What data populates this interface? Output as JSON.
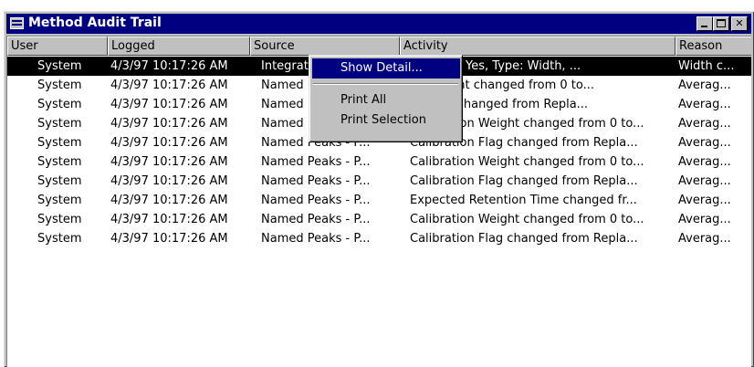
{
  "window": {
    "title": "Method Audit Trail",
    "min_glyph": "",
    "max_glyph": "",
    "close_glyph": "✕"
  },
  "columns": [
    "User",
    "Logged",
    "Source",
    "Activity",
    "Reason"
  ],
  "rows": [
    {
      "user": "System",
      "logged": "4/3/97 10:17:26 AM",
      "source": "Integrat",
      "activity": "Enabled: Yes, Type: Width, ...",
      "reason": "Width c...",
      "selected": true
    },
    {
      "user": "System",
      "logged": "4/3/97 10:17:26 AM",
      "source": "Named",
      "activity": "on Weight changed from 0 to...",
      "reason": "Averag..."
    },
    {
      "user": "System",
      "logged": "4/3/97 10:17:26 AM",
      "source": "Named",
      "activity": "on Flag changed from Repla...",
      "reason": "Averag..."
    },
    {
      "user": "System",
      "logged": "4/3/97 10:17:26 AM",
      "source": "Named Peaks - P...",
      "activity": "Calibration Weight changed from 0 to...",
      "reason": "Averag..."
    },
    {
      "user": "System",
      "logged": "4/3/97 10:17:26 AM",
      "source": "Named Peaks - P...",
      "activity": "Calibration Flag changed from Repla...",
      "reason": "Averag..."
    },
    {
      "user": "System",
      "logged": "4/3/97 10:17:26 AM",
      "source": "Named Peaks - P...",
      "activity": "Calibration Weight changed from 0 to...",
      "reason": "Averag..."
    },
    {
      "user": "System",
      "logged": "4/3/97 10:17:26 AM",
      "source": "Named Peaks - P...",
      "activity": "Calibration Flag changed from Repla...",
      "reason": "Averag..."
    },
    {
      "user": "System",
      "logged": "4/3/97 10:17:26 AM",
      "source": "Named Peaks - P...",
      "activity": "Expected Retention Time changed fr...",
      "reason": "Averag..."
    },
    {
      "user": "System",
      "logged": "4/3/97 10:17:26 AM",
      "source": "Named Peaks - P...",
      "activity": "Calibration Weight changed from 0 to...",
      "reason": "Averag..."
    },
    {
      "user": "System",
      "logged": "4/3/97 10:17:26 AM",
      "source": "Named Peaks - P...",
      "activity": "Calibration Flag changed from Repla...",
      "reason": "Averag..."
    }
  ],
  "context_menu": {
    "items": [
      "Show Detail...",
      "Print All",
      "Print Selection"
    ],
    "highlighted": "Show Detail..."
  },
  "colors": {
    "title_bar": "#000080",
    "selection": "#000000",
    "chrome": "#c0c0c0"
  }
}
